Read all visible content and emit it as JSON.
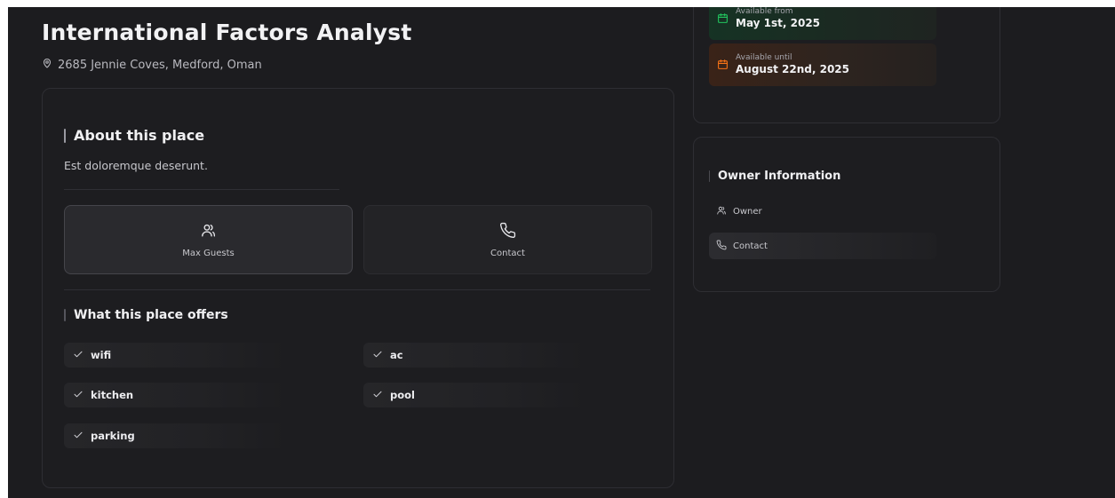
{
  "listing": {
    "title": "International Factors Analyst",
    "location": "2685 Jennie Coves, Medford, Oman"
  },
  "about": {
    "heading": "About this place",
    "description": "Est doloremque deserunt.",
    "stats": {
      "guests_label": "Max Guests",
      "contact_label": "Contact"
    }
  },
  "offers": {
    "heading": "What this place offers",
    "amenities": [
      "wifi",
      "ac",
      "kitchen",
      "pool",
      "parking"
    ]
  },
  "availability": {
    "from_label": "Available from",
    "from_date": "May 1st, 2025",
    "until_label": "Available until",
    "until_date": "August 22nd, 2025"
  },
  "owner": {
    "heading": "Owner Information",
    "owner_label": "Owner",
    "contact_label": "Contact"
  },
  "colors": {
    "background": "#1c1c1f",
    "available_from_accent": "#22c55e",
    "available_until_accent": "#f97316"
  },
  "icons": {
    "location": "map-pin-icon",
    "guests": "users-icon",
    "contact": "phone-icon",
    "amenity": "check-icon",
    "calendar": "calendar-icon"
  }
}
